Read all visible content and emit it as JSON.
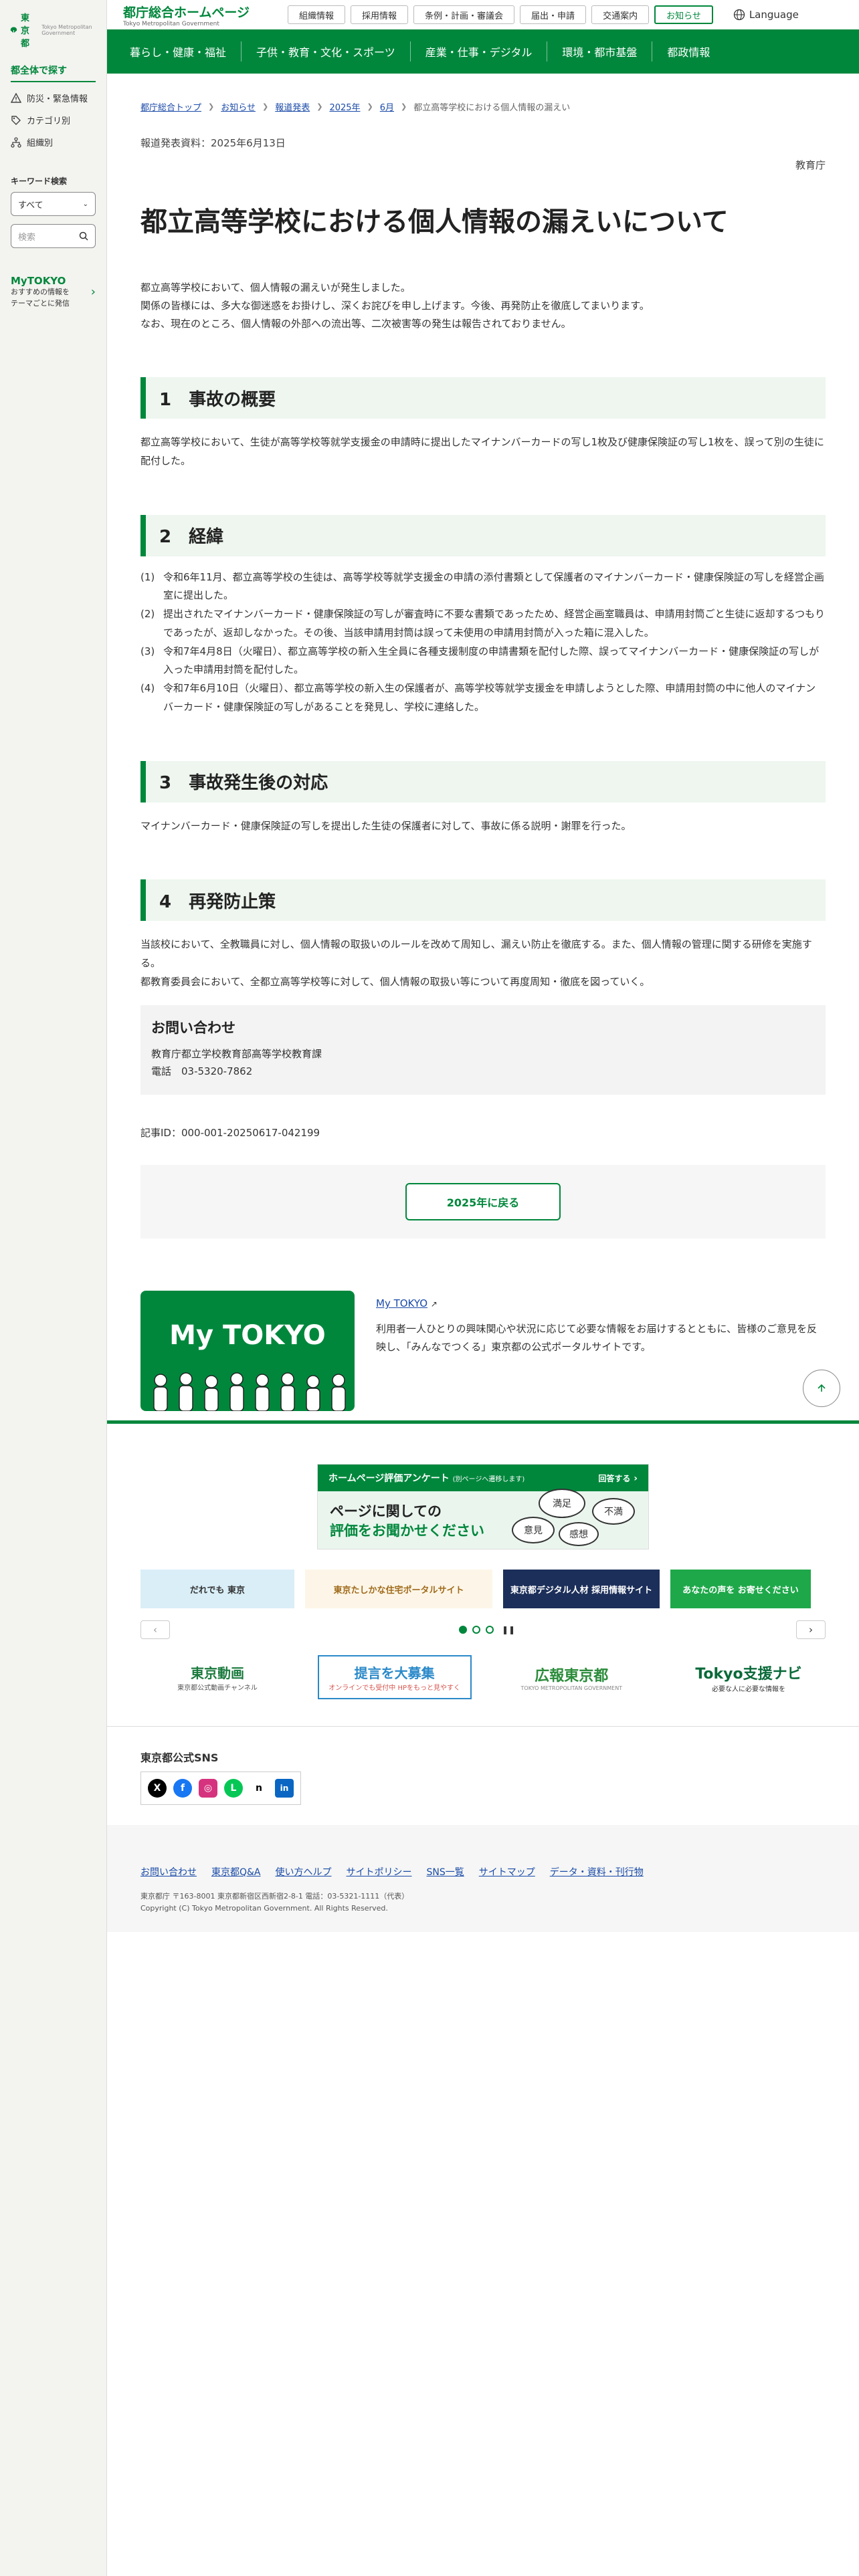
{
  "sidebar": {
    "logo_text": "東京都",
    "logo_sub": "Tokyo Metropolitan Government",
    "search_all": "都全体で探す",
    "links": [
      {
        "label": "防災・緊急情報",
        "icon": "warning-icon"
      },
      {
        "label": "カテゴリ別",
        "icon": "tag-icon"
      },
      {
        "label": "組織別",
        "icon": "org-chart-icon"
      }
    ],
    "keyword_label": "キーワード検索",
    "scope_value": "すべて",
    "search_placeholder": "検索",
    "mytokyo_label": "MyTOKYO",
    "mytokyo_desc": "おすすめの情報を\nテーマごとに発信"
  },
  "header": {
    "title": "都庁総合ホームページ",
    "subtitle": "Tokyo Metropolitan Government",
    "buttons": [
      "組織情報",
      "採用情報",
      "条例・計画・審議会",
      "届出・申請",
      "交通案内"
    ],
    "notice": "お知らせ",
    "language": "Language"
  },
  "gnav": [
    "暮らし・健康・福祉",
    "子供・教育・文化・スポーツ",
    "産業・仕事・デジタル",
    "環境・都市基盤",
    "都政情報"
  ],
  "breadcrumb": [
    "都庁総合トップ",
    "お知らせ",
    "報道発表",
    "2025年",
    "6月",
    "都立高等学校における個人情報の漏えい"
  ],
  "article": {
    "press_date": "報道発表資料：2025年6月13日",
    "dept": "教育庁",
    "title": "都立高等学校における個人情報の漏えいについて",
    "lead": [
      "都立高等学校において、個人情報の漏えいが発生しました。",
      "関係の皆様には、多大な御迷惑をお掛けし、深くお詫びを申し上げます。今後、再発防止を徹底してまいります。",
      "なお、現在のところ、個人情報の外部への流出等、二次被害等の発生は報告されておりません。"
    ],
    "s1_title": "1　事故の概要",
    "s1_text": "都立高等学校において、生徒が高等学校等就学支援金の申請時に提出したマイナンバーカードの写し1枚及び健康保険証の写し1枚を、誤って別の生徒に配付した。",
    "s2_title": "2　経緯",
    "s2_items": [
      {
        "num": "(1)",
        "text": "令和6年11月、都立高等学校の生徒は、高等学校等就学支援金の申請の添付書類として保護者のマイナンバーカード・健康保険証の写しを経営企画室に提出した。"
      },
      {
        "num": "(2)",
        "text": "提出されたマイナンバーカード・健康保険証の写しが審査時に不要な書類であったため、経営企画室職員は、申請用封筒ごと生徒に返却するつもりであったが、返却しなかった。その後、当該申請用封筒は誤って未使用の申請用封筒が入った箱に混入した。"
      },
      {
        "num": "(3)",
        "text": "令和7年4月8日（火曜日）、都立高等学校の新入生全員に各種支援制度の申請書類を配付した際、誤ってマイナンバーカード・健康保険証の写しが入った申請用封筒を配付した。"
      },
      {
        "num": "(4)",
        "text": "令和7年6月10日（火曜日）、都立高等学校の新入生の保護者が、高等学校等就学支援金を申請しようとした際、申請用封筒の中に他人のマイナンバーカード・健康保険証の写しがあることを発見し、学校に連絡した。"
      }
    ],
    "s3_title": "3　事故発生後の対応",
    "s3_text": "マイナンバーカード・健康保険証の写しを提出した生徒の保護者に対して、事故に係る説明・謝罪を行った。",
    "s4_title": "4　再発防止策",
    "s4_text": [
      "当該校において、全教職員に対し、個人情報の取扱いのルールを改めて周知し、漏えい防止を徹底する。また、個人情報の管理に関する研修を実施する。",
      "都教育委員会において、全都立高等学校等に対して、個人情報の取扱い等について再度周知・徹底を図っていく。"
    ],
    "contact_title": "お問い合わせ",
    "contact_dept": "教育庁都立学校教育部高等学校教育課",
    "contact_tel": "電話　03-5320-7862",
    "article_id": "記事ID：000-001-20250617-042199",
    "back_label": "2025年に戻る"
  },
  "mytokyo": {
    "img_title": "My TOKYO",
    "link": "My TOKYO",
    "desc": "利用者一人ひとりの興味関心や状況に応じて必要な情報をお届けするとともに、皆様のご意見を反映し、「みんなでつくる」東京都の公式ポータルサイトです。"
  },
  "footer": {
    "enquete_title": "ホームページ評価アンケート",
    "enquete_note": "(別ページへ遷移します)",
    "enquete_cta": "回答する",
    "enquete_body_1": "ページに関しての",
    "enquete_body_2": "評価をお聞かせください",
    "bubbles": [
      "満足",
      "不満",
      "意見",
      "感想"
    ],
    "carousel": [
      "だれでも 東京",
      "東京たしかな住宅ポータルサイト",
      "東京都デジタル人材 採用情報サイト",
      "あなたの声を お寄せください"
    ],
    "logos": [
      {
        "main": "東京動画",
        "sub": "東京都公式動画チャンネル"
      },
      {
        "main": "提言を大募集",
        "sub": "オンラインでも受付中 HPをもっと見やすく"
      },
      {
        "main": "広報東京都",
        "sub": "TOKYO METROPOLITAN GOVERNMENT"
      },
      {
        "main": "Tokyo支援ナビ",
        "sub": "必要な人に必要な情報を"
      }
    ],
    "sns_title": "東京都公式SNS",
    "sns": [
      "X",
      "f",
      "◎",
      "L",
      "n",
      "in"
    ],
    "links": [
      "お問い合わせ",
      "東京都Q&A",
      "使い方ヘルプ",
      "サイトポリシー",
      "SNS一覧",
      "サイトマップ",
      "データ・資料・刊行物"
    ],
    "address": "東京都庁 〒163-8001 東京都新宿区西新宿2-8-1 電話：03-5321-1111（代表）",
    "copyright": "Copyright (C) Tokyo Metropolitan Government. All Rights Reserved."
  }
}
